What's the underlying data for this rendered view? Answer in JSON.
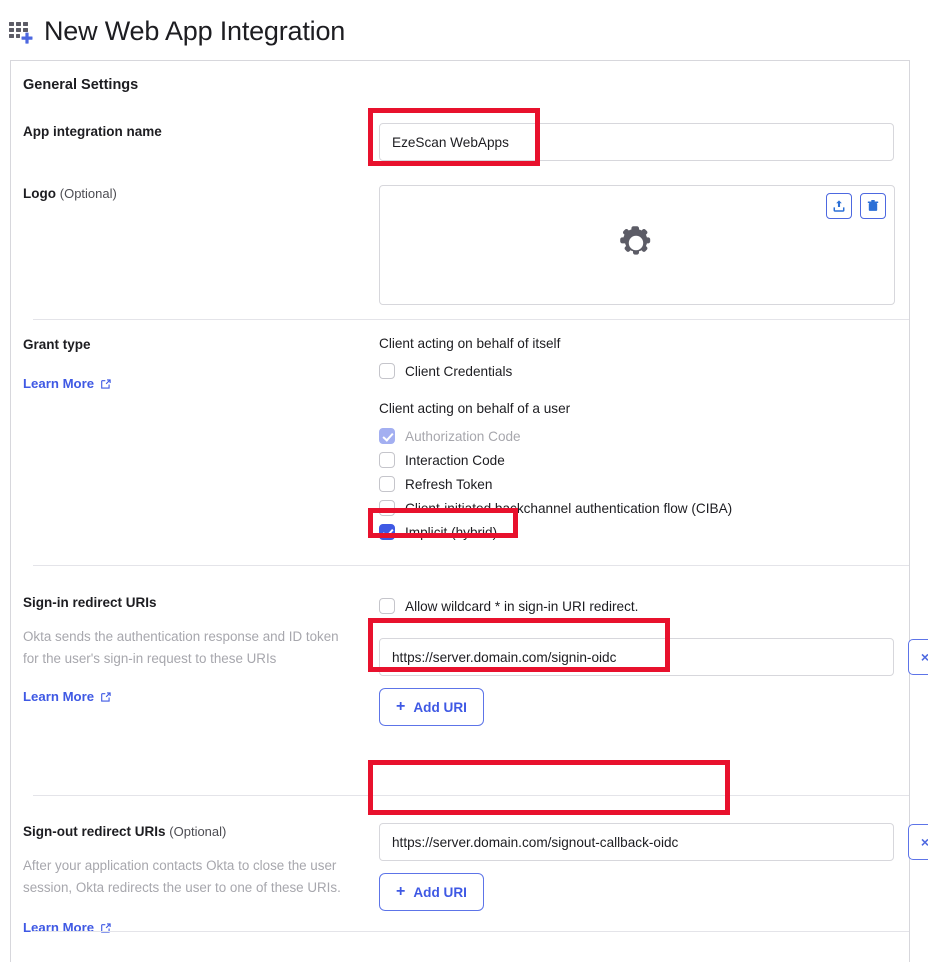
{
  "header": {
    "title": "New Web App Integration",
    "icon": "apps-grid-plus-icon"
  },
  "card": {
    "title": "General Settings"
  },
  "app_name": {
    "label": "App integration name",
    "value": "EzeScan WebApps"
  },
  "logo": {
    "label": "Logo",
    "optional": "(Optional)",
    "placeholder_icon": "gear-icon",
    "upload_icon": "upload-icon",
    "delete_icon": "trash-icon"
  },
  "grant_type": {
    "label": "Grant type",
    "learn_more": "Learn More",
    "group_itself": "Client acting on behalf of itself",
    "group_user": "Client acting on behalf of a user",
    "options_itself": [
      {
        "label": "Client Credentials",
        "checked": false,
        "disabled": false
      }
    ],
    "options_user": [
      {
        "label": "Authorization Code",
        "checked": true,
        "disabled": true
      },
      {
        "label": "Interaction Code",
        "checked": false,
        "disabled": false
      },
      {
        "label": "Refresh Token",
        "checked": false,
        "disabled": false
      },
      {
        "label": "Client-initiated backchannel authentication flow (CIBA)",
        "checked": false,
        "disabled": false
      },
      {
        "label": "Implicit (hybrid)",
        "checked": true,
        "disabled": false
      }
    ]
  },
  "signin": {
    "label": "Sign-in redirect URIs",
    "helper": "Okta sends the authentication response and ID token for the user's sign-in request to these URIs",
    "learn_more": "Learn More",
    "wildcard_label": "Allow wildcard * in sign-in URI redirect.",
    "wildcard_checked": false,
    "uri_value": "https://server.domain.com/signin-oidc",
    "remove_label": "×",
    "add_label": "Add URI",
    "add_plus": "+"
  },
  "signout": {
    "label": "Sign-out redirect URIs",
    "optional": "(Optional)",
    "helper": "After your application contacts Okta to close the user session, Okta redirects the user to one of these URIs.",
    "learn_more": "Learn More",
    "uri_value": "https://server.domain.com/signout-callback-oidc",
    "remove_label": "×",
    "add_label": "Add URI",
    "add_plus": "+"
  },
  "colors": {
    "accent": "#3f59e4",
    "annotation": "#e8112d",
    "border": "#d7d7dc",
    "helper_text": "#a7a7ad"
  }
}
